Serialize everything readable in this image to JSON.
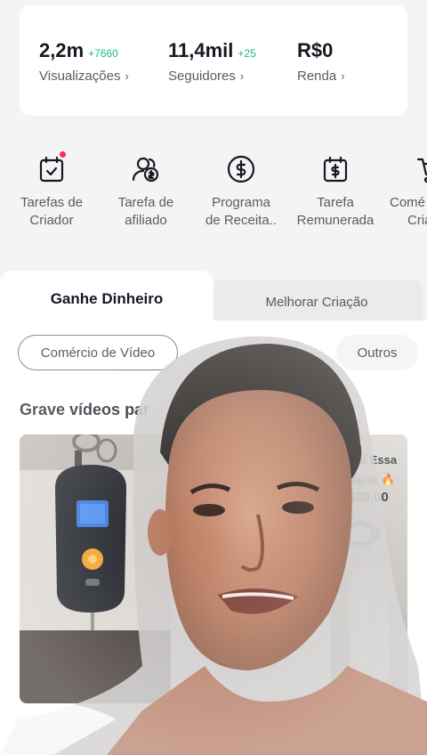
{
  "stats": [
    {
      "value": "2,2m",
      "delta": "+7660",
      "label": "Visualizações"
    },
    {
      "value": "11,4mil",
      "delta": "+25",
      "label": "Seguidores"
    },
    {
      "value": "R$0",
      "delta": "",
      "label": "Renda"
    }
  ],
  "tools": [
    {
      "line1": "Tarefas de",
      "line2": "Criador"
    },
    {
      "line1": "Tarefa de",
      "line2": "afiliado"
    },
    {
      "line1": "Programa",
      "line2": "de Receita.."
    },
    {
      "line1": "Tarefa",
      "line2": "Remunerada"
    },
    {
      "line1": "Comé",
      "line2": "Cria"
    }
  ],
  "tabs": {
    "active": "Ganhe Dinheiro",
    "inactive": "Melhorar Criação"
  },
  "chips": [
    "Comércio de Vídeo",
    "Outros"
  ],
  "section_title": "Grave vídeos par",
  "product_card": {
    "title_line1": "vai Essa",
    "title_line2": "água 🔥",
    "price": "R$30,00"
  }
}
